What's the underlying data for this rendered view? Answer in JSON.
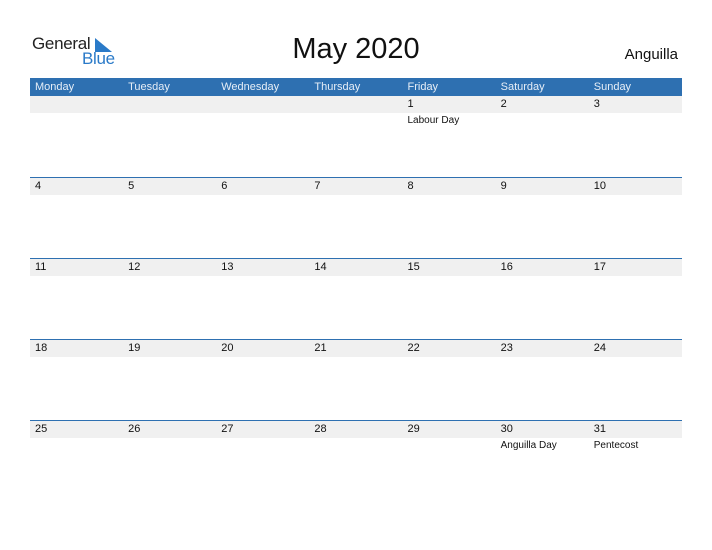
{
  "logo": {
    "line1": "General",
    "line2": "Blue",
    "icon": "triangle-flag-icon",
    "brand_color": "#2a7ac8"
  },
  "title": "May 2020",
  "country": "Anguilla",
  "colors": {
    "header_bg": "#2e70b1",
    "date_strip": "#f0f0f0"
  },
  "weekdays": [
    "Monday",
    "Tuesday",
    "Wednesday",
    "Thursday",
    "Friday",
    "Saturday",
    "Sunday"
  ],
  "weeks": [
    {
      "days": [
        {
          "num": "",
          "holiday": ""
        },
        {
          "num": "",
          "holiday": ""
        },
        {
          "num": "",
          "holiday": ""
        },
        {
          "num": "",
          "holiday": ""
        },
        {
          "num": "1",
          "holiday": "Labour Day"
        },
        {
          "num": "2",
          "holiday": ""
        },
        {
          "num": "3",
          "holiday": ""
        }
      ]
    },
    {
      "days": [
        {
          "num": "4",
          "holiday": ""
        },
        {
          "num": "5",
          "holiday": ""
        },
        {
          "num": "6",
          "holiday": ""
        },
        {
          "num": "7",
          "holiday": ""
        },
        {
          "num": "8",
          "holiday": ""
        },
        {
          "num": "9",
          "holiday": ""
        },
        {
          "num": "10",
          "holiday": ""
        }
      ]
    },
    {
      "days": [
        {
          "num": "11",
          "holiday": ""
        },
        {
          "num": "12",
          "holiday": ""
        },
        {
          "num": "13",
          "holiday": ""
        },
        {
          "num": "14",
          "holiday": ""
        },
        {
          "num": "15",
          "holiday": ""
        },
        {
          "num": "16",
          "holiday": ""
        },
        {
          "num": "17",
          "holiday": ""
        }
      ]
    },
    {
      "days": [
        {
          "num": "18",
          "holiday": ""
        },
        {
          "num": "19",
          "holiday": ""
        },
        {
          "num": "20",
          "holiday": ""
        },
        {
          "num": "21",
          "holiday": ""
        },
        {
          "num": "22",
          "holiday": ""
        },
        {
          "num": "23",
          "holiday": ""
        },
        {
          "num": "24",
          "holiday": ""
        }
      ]
    },
    {
      "days": [
        {
          "num": "25",
          "holiday": ""
        },
        {
          "num": "26",
          "holiday": ""
        },
        {
          "num": "27",
          "holiday": ""
        },
        {
          "num": "28",
          "holiday": ""
        },
        {
          "num": "29",
          "holiday": ""
        },
        {
          "num": "30",
          "holiday": "Anguilla Day"
        },
        {
          "num": "31",
          "holiday": "Pentecost"
        }
      ]
    }
  ]
}
